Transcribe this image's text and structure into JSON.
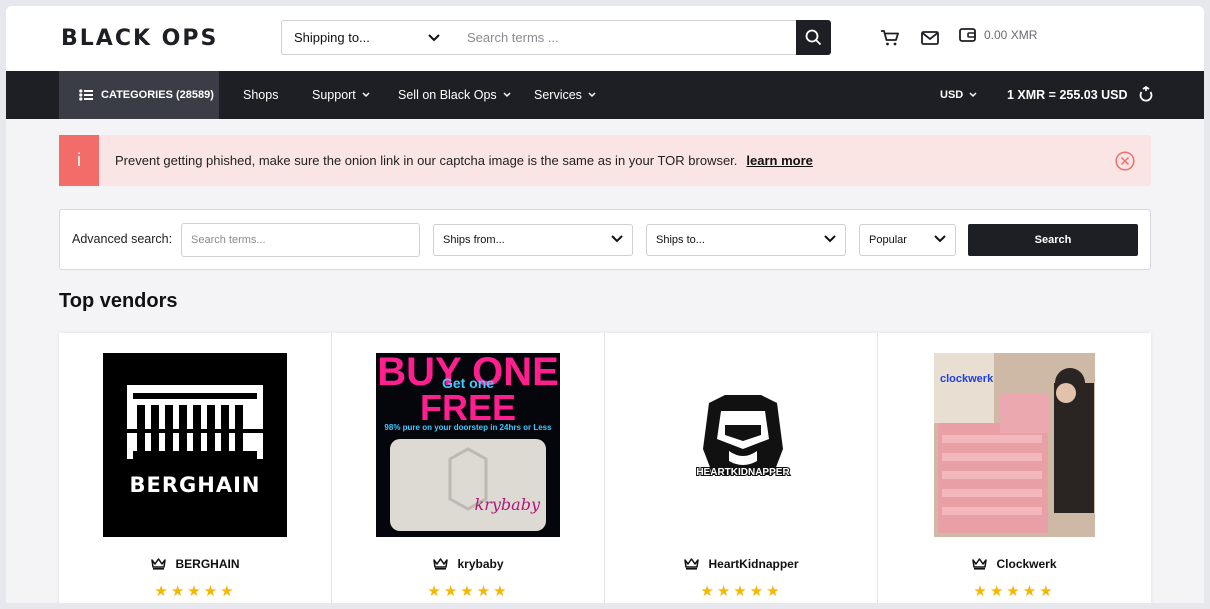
{
  "header": {
    "logo": "BLACK OPS",
    "shipping_select": "Shipping to...",
    "search_placeholder": "Search terms ...",
    "wallet_balance": "0.00 XMR"
  },
  "nav": {
    "categories_label": "CATEGORIES (28589)",
    "items": [
      {
        "label": "Shops",
        "dropdown": false
      },
      {
        "label": "Support",
        "dropdown": true
      },
      {
        "label": "Sell on Black Ops",
        "dropdown": true
      },
      {
        "label": "Services",
        "dropdown": true
      }
    ],
    "currency": "USD",
    "exchange_rate": "1 XMR = 255.03 USD"
  },
  "alert": {
    "icon": "i",
    "message": "Prevent getting phished, make sure the onion link in our captcha image is the same as in your TOR browser.",
    "link": "learn more"
  },
  "advanced_search": {
    "label": "Advanced search:",
    "input_placeholder": "Search terms...",
    "ships_from": "Ships from...",
    "ships_to": "Ships to...",
    "sort": "Popular",
    "button": "Search"
  },
  "top_vendors": {
    "title": "Top vendors",
    "vendors": [
      {
        "name": "BERGHAIN",
        "image_text": "BERGHAIN",
        "rating": 5
      },
      {
        "name": "krybaby",
        "image_text_top": "BUY ONE",
        "image_text_mid": "Get one",
        "image_text_bottom": "FREE",
        "image_caption": "98% pure on your doorstep in 24hrs or Less",
        "image_script": "krybaby",
        "rating": 5
      },
      {
        "name": "HeartKidnapper",
        "image_text": "HEARTKIDNAPPER",
        "rating": 5
      },
      {
        "name": "Clockwerk",
        "image_text": "clockwerk",
        "rating": 5
      }
    ]
  },
  "colors": {
    "dark": "#1d1f24",
    "alert_bg": "#fbe4e4",
    "alert_accent": "#f26d6a",
    "star": "#f5b700"
  }
}
